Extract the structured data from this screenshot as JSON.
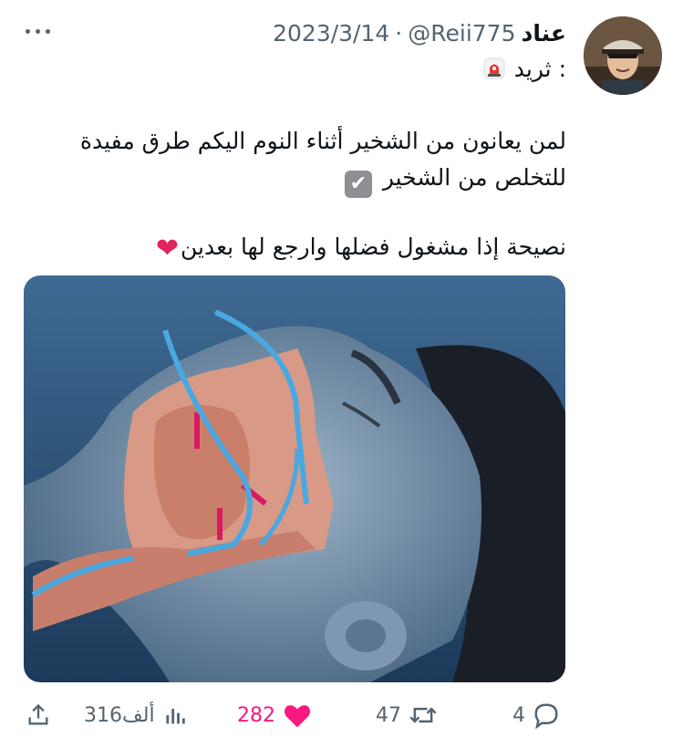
{
  "tweet": {
    "author_name": "عناد",
    "handle": "@Reii775",
    "separator": "·",
    "date": "2023/3/14",
    "thread_label": "ثريد :",
    "thread_emoji": "🚨",
    "line1": "لمن يعانون من الشخير أثناء النوم اليكم طرق مفيدة",
    "line2": "للتخلص من الشخير",
    "line3": "نصيحة إذا مشغول فضلها وارجع لها بعدين",
    "check_emoji": "✔",
    "heart_emoji": "❤"
  },
  "metrics": {
    "replies": "4",
    "retweets": "47",
    "likes": "282",
    "views": "316ألف"
  },
  "icons": [
    "reply-icon",
    "retweet-icon",
    "like-icon",
    "views-icon",
    "share-icon",
    "more-icon"
  ],
  "colors": {
    "like": "#f91880",
    "muted": "#536471",
    "text": "#0f1419"
  }
}
